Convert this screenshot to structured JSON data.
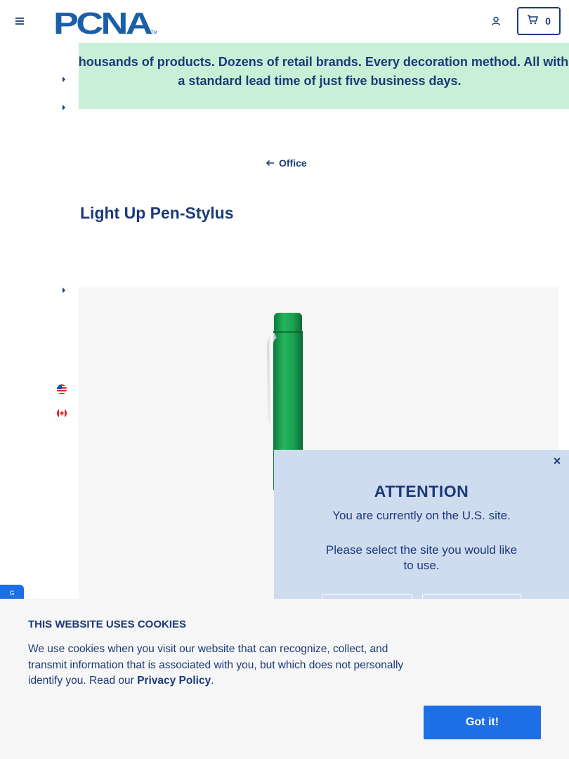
{
  "header": {
    "logo_text": "PCNA",
    "logo_tm": "TM",
    "cart_count": "0",
    "brand_color": "#1b3a78"
  },
  "banner": {
    "text": "Thousands of products. Dozens of retail brands. Every decoration method. All with a standard lead time of just five business days.",
    "background": "#c8f0d7"
  },
  "breadcrumb": {
    "back_label": "Office"
  },
  "product": {
    "title": "Light Up Pen-Stylus",
    "color": "#1aa052"
  },
  "attention_modal": {
    "title": "ATTENTION",
    "line1": "You are currently on the U.S. site.",
    "line2": "Please select the site you would like to use.",
    "close_label": "×"
  },
  "side_tab": {
    "label": "G"
  },
  "cookie": {
    "title": "THIS WEBSITE USES COOKIES",
    "text_before": "We use cookies when you visit our website that can recognize, collect, and transmit information that is associated with you, but which does not personally identify you. Read our ",
    "link": "Privacy Policy",
    "text_after": ".",
    "button": "Got it!",
    "button_color": "#1e6ee6"
  }
}
